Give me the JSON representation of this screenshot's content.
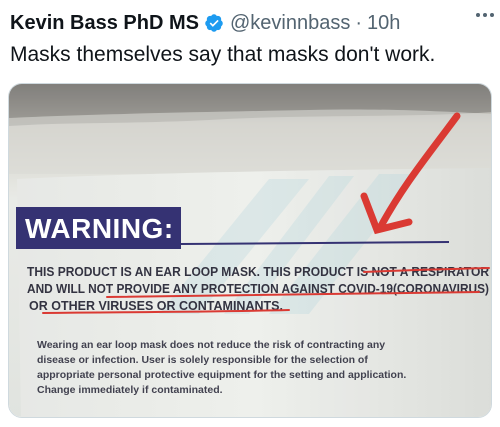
{
  "tweet": {
    "author_name": "Kevin Bass PhD MS",
    "handle": "@kevinnbass",
    "separator": "·",
    "timestamp": "10h",
    "text": "Masks themselves say that masks don't work."
  },
  "media": {
    "label_heading": "WARNING:",
    "label_lines": [
      "THIS PRODUCT IS AN EAR LOOP MASK. THIS PRODUCT IS NOT A RESPIRATOR",
      "AND WILL NOT PROVIDE ANY PROTECTION AGAINST COVID-19(CORONAVIRUS)",
      "OR OTHER VIRUSES OR CONTAMINANTS."
    ],
    "label_small_lines": [
      "Wearing an ear loop mask does not reduce the risk of contracting any",
      "disease or infection. User is solely responsible for the selection of",
      "appropriate personal protective equipment for the setting and application.",
      "Change immediately if contaminated."
    ]
  },
  "colors": {
    "verified_blue": "#1d9bf0",
    "warning_banner": "#2d2a6e",
    "annotation_red": "#d9322b"
  },
  "icons": [
    "verified-badge-icon",
    "more-options-icon",
    "red-arrow-annotation"
  ]
}
